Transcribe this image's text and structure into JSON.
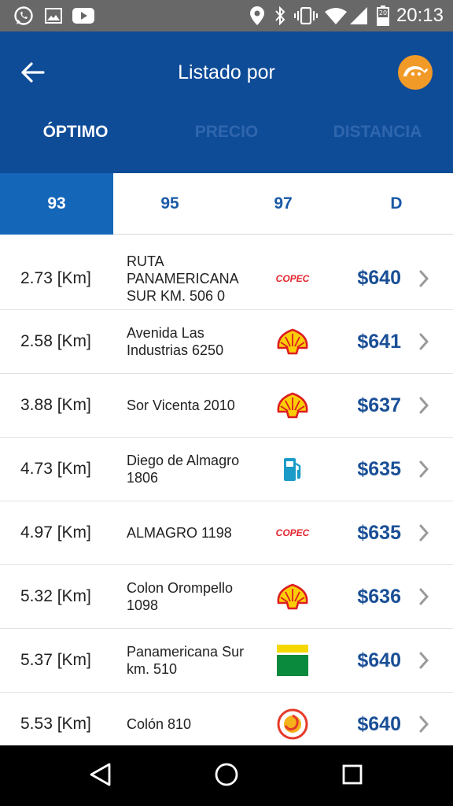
{
  "status_bar": {
    "time": "20:13",
    "icons": [
      "whatsapp-icon",
      "gallery-icon",
      "youtube-icon",
      "location-icon",
      "bluetooth-icon",
      "vibrate-icon",
      "wifi-icon",
      "signal-icon",
      "battery-icon"
    ],
    "battery_level": "20"
  },
  "header": {
    "title": "Listado por",
    "back_icon": "arrow-left-icon",
    "logo_icon": "fuel-logo-icon",
    "sort_tabs": [
      {
        "label": "ÓPTIMO",
        "active": true
      },
      {
        "label": "PRECIO",
        "active": false
      },
      {
        "label": "DISTANCIA",
        "active": false
      }
    ]
  },
  "fuel_tabs": [
    {
      "label": "93",
      "active": true
    },
    {
      "label": "95",
      "active": false
    },
    {
      "label": "97",
      "active": false
    },
    {
      "label": "D",
      "active": false
    }
  ],
  "stations": [
    {
      "distance": "2.73 [Km]",
      "address": "RUTA PANAMERICANA SUR KM. 506 0",
      "brand": "copec",
      "brand_text": "COPEC",
      "price": "$640"
    },
    {
      "distance": "2.58 [Km]",
      "address": "Avenida Las Industrias 6250",
      "brand": "shell",
      "price": "$641"
    },
    {
      "distance": "3.88 [Km]",
      "address": "Sor Vicenta 2010",
      "brand": "shell",
      "price": "$637"
    },
    {
      "distance": "4.73 [Km]",
      "address": "Diego de Almagro 1806",
      "brand": "generic-pump",
      "price": "$635"
    },
    {
      "distance": "4.97 [Km]",
      "address": "ALMAGRO 1198",
      "brand": "copec",
      "brand_text": "COPEC",
      "price": "$635"
    },
    {
      "distance": "5.32 [Km]",
      "address": "Colon Orompello 1098",
      "brand": "shell",
      "price": "$636"
    },
    {
      "distance": "5.37 [Km]",
      "address": "Panamericana Sur km. 510",
      "brand": "petrobras",
      "price": "$640"
    },
    {
      "distance": "5.53 [Km]",
      "address": "Colón 810",
      "brand": "terpel",
      "price": "$640"
    }
  ],
  "colors": {
    "app_bar": "#0f4c98",
    "active_fuel_tab": "#1466b8",
    "price_text": "#1a4f96",
    "logo_orange": "#f29a28",
    "copec_red": "#e3262f",
    "shell_yellow": "#fbce07",
    "shell_red": "#dd1d21"
  },
  "nav_bar": {
    "icons": [
      "back-triangle-icon",
      "home-circle-icon",
      "recents-square-icon"
    ]
  }
}
